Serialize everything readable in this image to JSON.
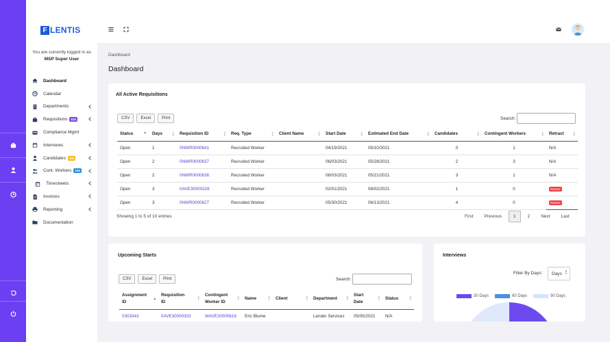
{
  "brand": {
    "logo_letter": "F",
    "logo_rest": "LENTIS"
  },
  "session": {
    "logged_in_text": "You are currently logged in as",
    "user": "MSP Super User"
  },
  "rail": {
    "icons": [
      "briefcase-icon",
      "user-icon",
      "clock-icon",
      "logout-icon",
      "power-icon"
    ]
  },
  "sidebar": {
    "items": [
      {
        "label": "Dashboard",
        "icon": "home-icon"
      },
      {
        "label": "Calendar",
        "icon": "clock-icon"
      },
      {
        "label": "Departments",
        "icon": "building-icon"
      },
      {
        "label": "Requisitions",
        "icon": "briefcase-icon",
        "badge": "515",
        "badge_color": "#7b4ae8"
      },
      {
        "label": "Compliance Mgmt",
        "icon": "id-card-icon"
      },
      {
        "label": "Interviews",
        "icon": "calendar-icon"
      },
      {
        "label": "Candidates",
        "icon": "user-icon",
        "badge": "989",
        "badge_color": "#f2b713"
      },
      {
        "label": "Cont. Workers",
        "icon": "users-icon",
        "badge": "156",
        "badge_color": "#2a8fd8"
      },
      {
        "label": "Timesheets",
        "icon": "timesheet-icon"
      },
      {
        "label": "Invoices",
        "icon": "invoice-icon"
      },
      {
        "label": "Reporting",
        "icon": "printer-icon"
      },
      {
        "label": "Documentation",
        "icon": "folder-icon"
      }
    ]
  },
  "breadcrumb": "Dashboard",
  "page_title": "Dashboard",
  "requisitions": {
    "title": "All Active Requisitions",
    "buttons": [
      "CSV",
      "Excel",
      "Print"
    ],
    "search_label": "Search:",
    "columns": [
      "Status",
      "Days",
      "Requisition ID",
      "Req. Type",
      "Client Name",
      "Start Date",
      "Estimated End Date",
      "Candidates",
      "Contingent Workers",
      "Retract"
    ],
    "rows": [
      {
        "status": "Open",
        "days": "1",
        "id": "0NWR0000641",
        "type": "Recruited Worker",
        "client": "",
        "start": "04/19/2021",
        "end": "05/10/2021",
        "candidates": "0",
        "workers": "1",
        "retract": "N/A"
      },
      {
        "status": "Open",
        "days": "2",
        "id": "0NWR0000637",
        "type": "Recruited Worker",
        "client": "",
        "start": "06/03/2021",
        "end": "05/28/2021",
        "candidates": "2",
        "workers": "3",
        "retract": "N/A"
      },
      {
        "status": "Open",
        "days": "2",
        "id": "0NWR0000636",
        "type": "Recruited Worker",
        "client": "",
        "start": "06/03/2021",
        "end": "05/21/2021",
        "candidates": "3",
        "workers": "1",
        "retract": "N/A"
      },
      {
        "status": "Open",
        "days": "3",
        "id": "0AVE30000328",
        "type": "Recruited Worker",
        "client": "",
        "start": "02/01/2021",
        "end": "08/02/2021",
        "candidates": "1",
        "workers": "0",
        "retract": "Retract"
      },
      {
        "status": "Open",
        "days": "3",
        "id": "0NWR0000627",
        "type": "Recruited Worker",
        "client": "",
        "start": "05/30/2021",
        "end": "06/13/2021",
        "candidates": "4",
        "workers": "0",
        "retract": "Retract"
      }
    ],
    "info": "Showing 1 to 5 of 10 entries",
    "pager": {
      "first": "First",
      "previous": "Previous",
      "pages": [
        "1",
        "2"
      ],
      "next": "Next",
      "last": "Last"
    }
  },
  "upcoming": {
    "title": "Upcoming Starts",
    "buttons": [
      "CSV",
      "Excel",
      "Print"
    ],
    "search_label": "Search:",
    "columns": [
      [
        "Assignment",
        "ID"
      ],
      [
        "Requisition",
        "ID"
      ],
      [
        "Contingent",
        "Worker ID"
      ],
      [
        "Name",
        ""
      ],
      [
        "Client",
        ""
      ],
      [
        "Department",
        ""
      ],
      [
        "Start",
        "Date"
      ],
      [
        "Status",
        ""
      ]
    ],
    "rows": [
      {
        "assignment": "0303343",
        "requisition": "0AVE30000303",
        "worker": "WAVE30000618",
        "name": "Eric Blume",
        "client": "",
        "department": "Lender Services",
        "start": "05/05/2021",
        "status": "N/A"
      }
    ]
  },
  "interviews": {
    "title": "Interviews",
    "filter_label": "Filter By Days:",
    "filter_value": "Days",
    "legend": [
      {
        "label": "30 Days",
        "color": "#6c4af0"
      },
      {
        "label": "60 Days",
        "color": "#4a8fe8"
      },
      {
        "label": "90 Days",
        "color": "#d6e4fb"
      }
    ]
  }
}
